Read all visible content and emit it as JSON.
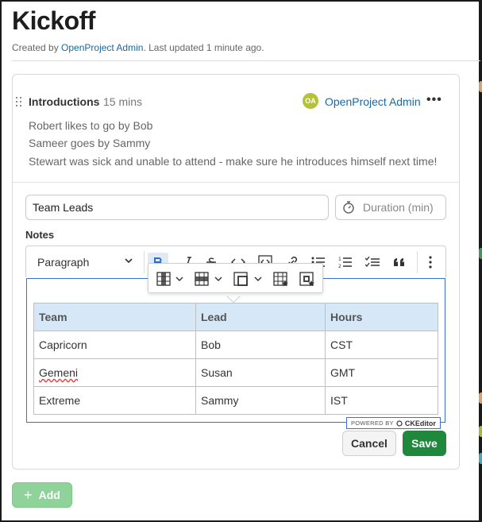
{
  "page": {
    "title": "Kickoff",
    "subtitle_prefix": "Created by ",
    "subtitle_author": "OpenProject Admin",
    "subtitle_suffix": ". Last updated 1 minute ago."
  },
  "agenda_item": {
    "title": "Introductions",
    "duration": "15 mins",
    "owner_initials": "OA",
    "owner_name": "OpenProject Admin",
    "more_label": "•••",
    "notes": [
      "Robert likes to go by Bob",
      "Sameer goes by Sammy",
      "Stewart was sick and unable to attend - make sure he introduces himself next time!"
    ]
  },
  "form": {
    "title_value": "Team Leads",
    "duration_placeholder": "Duration (min)",
    "notes_label": "Notes",
    "paragraph_select": "Paragraph",
    "table": {
      "headers": [
        "Team",
        "Lead",
        "Hours"
      ],
      "rows": [
        [
          "Capricorn",
          "Bob",
          "CST"
        ],
        [
          "Gemeni",
          "Susan",
          "GMT"
        ],
        [
          "Extreme",
          "Sammy",
          "IST"
        ]
      ]
    },
    "powered_by": "POWERED BY",
    "powered_brand": "CKEditor",
    "cancel_label": "Cancel",
    "save_label": "Save"
  },
  "add_label": "Add",
  "colors": {
    "link": "#1a67a3",
    "save": "#1f883d",
    "add": "#8fd39b",
    "avatar": "#b5c13b",
    "table_header": "#d6e8f8",
    "editor_focus": "#3b6fd6"
  }
}
